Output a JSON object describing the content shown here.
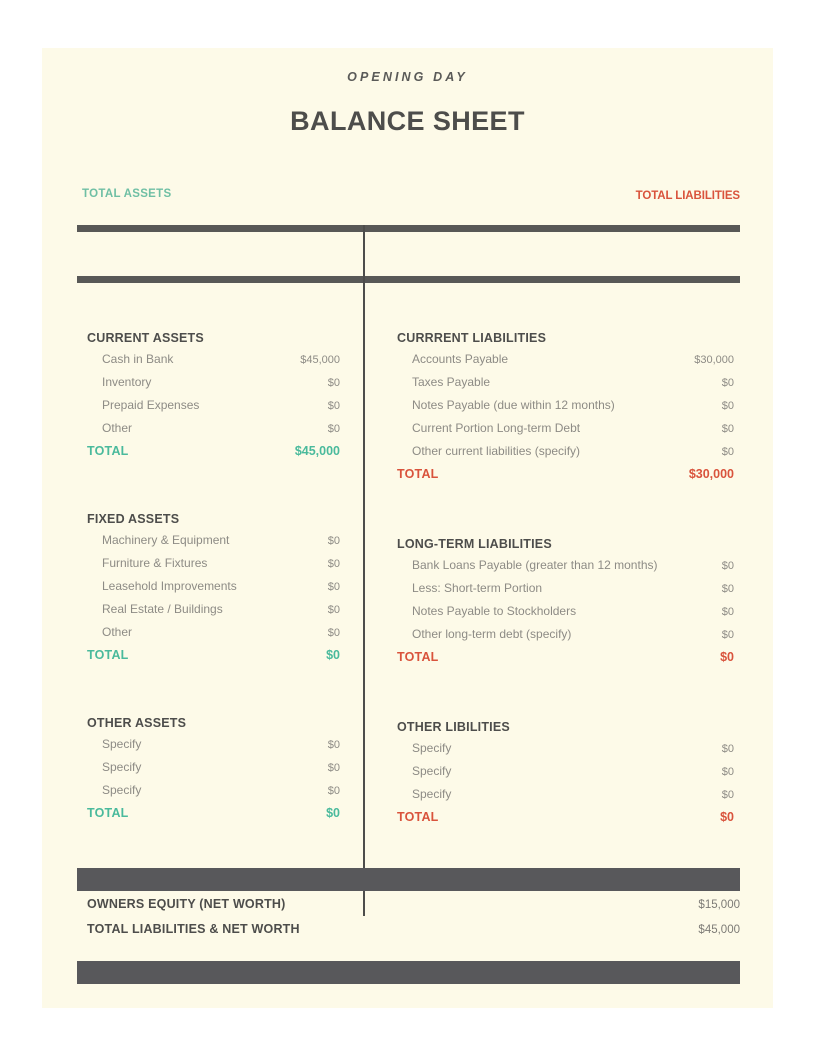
{
  "document": {
    "eyebrow": "OPENING DAY",
    "title": "BALANCE SHEET"
  },
  "captions": {
    "assets": "TOTAL ASSETS",
    "liabilities": "TOTAL LIABILITIES"
  },
  "colors": {
    "page_background": "#fdfae8",
    "outer_background": "#ffffff",
    "assets_accent": "#4aba9c",
    "liabilities_accent": "#d9533c",
    "rule_dark": "#58585b",
    "heading_text": "#4d4d4b",
    "body_text": "#8d8b85"
  },
  "assets": {
    "current": {
      "title": "CURRENT ASSETS",
      "rows": [
        {
          "label": "Cash in Bank",
          "value": "$45,000"
        },
        {
          "label": "Inventory",
          "value": "$0"
        },
        {
          "label": "Prepaid Expenses",
          "value": "$0"
        },
        {
          "label": "Other",
          "value": "$0"
        }
      ],
      "total": {
        "label": "TOTAL",
        "value": "$45,000"
      }
    },
    "fixed": {
      "title": "FIXED ASSETS",
      "rows": [
        {
          "label": "Machinery & Equipment",
          "value": "$0"
        },
        {
          "label": "Furniture & Fixtures",
          "value": "$0"
        },
        {
          "label": "Leasehold Improvements",
          "value": "$0"
        },
        {
          "label": "Real Estate / Buildings",
          "value": "$0"
        },
        {
          "label": "Other",
          "value": "$0"
        }
      ],
      "total": {
        "label": "TOTAL",
        "value": "$0"
      }
    },
    "other": {
      "title": "OTHER ASSETS",
      "rows": [
        {
          "label": "Specify",
          "value": "$0"
        },
        {
          "label": "Specify",
          "value": "$0"
        },
        {
          "label": "Specify",
          "value": "$0"
        }
      ],
      "total": {
        "label": "TOTAL",
        "value": "$0"
      }
    }
  },
  "liabilities": {
    "current": {
      "title": "CURRRENT LIABILITIES",
      "rows": [
        {
          "label": "Accounts Payable",
          "value": "$30,000"
        },
        {
          "label": "Taxes Payable",
          "value": "$0"
        },
        {
          "label": "Notes Payable (due within 12 months)",
          "value": "$0"
        },
        {
          "label": "Current Portion Long-term Debt",
          "value": "$0"
        },
        {
          "label": "Other current liabilities (specify)",
          "value": "$0"
        }
      ],
      "total": {
        "label": "TOTAL",
        "value": "$30,000"
      }
    },
    "longterm": {
      "title": "LONG-TERM LIABILITIES",
      "rows": [
        {
          "label": "Bank Loans Payable (greater than 12 months)",
          "value": "$0"
        },
        {
          "label": "Less: Short-term Portion",
          "value": "$0"
        },
        {
          "label": "Notes Payable to Stockholders",
          "value": "$0"
        },
        {
          "label": "Other long-term debt (specify)",
          "value": "$0"
        }
      ],
      "total": {
        "label": "TOTAL",
        "value": "$0"
      }
    },
    "other": {
      "title": "OTHER LIBILITIES",
      "rows": [
        {
          "label": "Specify",
          "value": "$0"
        },
        {
          "label": "Specify",
          "value": "$0"
        },
        {
          "label": "Specify",
          "value": "$0"
        }
      ],
      "total": {
        "label": "TOTAL",
        "value": "$0"
      }
    }
  },
  "summary": {
    "rows": [
      {
        "label": "OWNERS EQUITY (NET WORTH)",
        "value": "$15,000"
      },
      {
        "label": "TOTAL LIABILITIES & NET WORTH",
        "value": "$45,000"
      }
    ]
  }
}
